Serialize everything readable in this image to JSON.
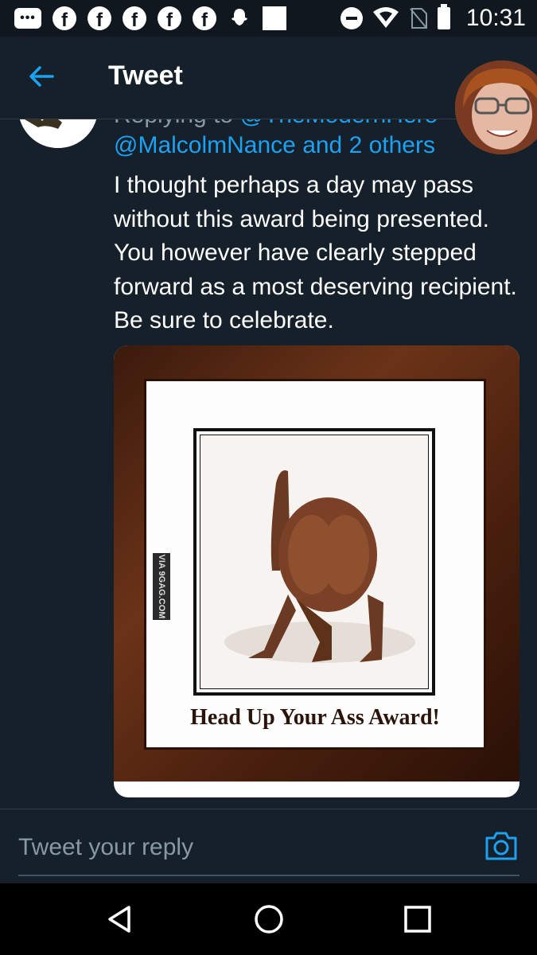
{
  "status_bar": {
    "time": "10:31",
    "notification_icons": [
      "messages-icon",
      "facebook-icon",
      "facebook-icon",
      "facebook-icon",
      "facebook-icon",
      "facebook-icon",
      "snapchat-icon",
      "placeholder-square-icon"
    ],
    "system_icons": [
      "do-not-disturb-icon",
      "wifi-icon",
      "no-sim-icon",
      "battery-icon"
    ]
  },
  "header": {
    "title": "Tweet",
    "back_icon": "arrow-left-icon"
  },
  "tweet": {
    "replying_prefix": "Replying to",
    "replying_handle": "@TheModernHero",
    "mention_line": "@MalcolmNance and 2 others",
    "text": "I thought perhaps a day may pass without this award being presented. You however have clearly stepped forward as a most deserving recipient. Be sure to celebrate.",
    "media": {
      "caption": "Head Up Your Ass Award!",
      "watermark": "VIA 9GAG.COM"
    }
  },
  "composer": {
    "placeholder": "Tweet your reply",
    "camera_icon": "camera-icon"
  },
  "nav": {
    "back_icon": "triangle-back-icon",
    "home_icon": "circle-home-icon",
    "recents_icon": "square-recents-icon"
  },
  "colors": {
    "background": "#15202b",
    "status_bar": "#10171e",
    "accent": "#1da1f2",
    "muted": "#8899a6"
  }
}
